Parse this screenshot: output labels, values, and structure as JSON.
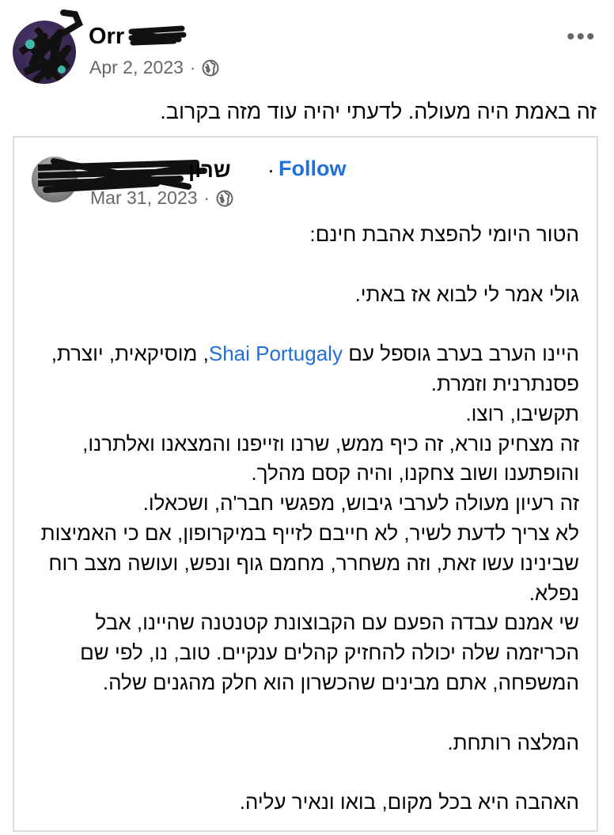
{
  "post": {
    "author": "Orr",
    "date": "Apr 2, 2023",
    "separator": "·",
    "more": "•••",
    "text": "זה באמת היה מעולה. לדעתי יהיה עוד מזה בקרוב."
  },
  "shared": {
    "author_visible": "שרון",
    "separator": "·",
    "follow": "Follow",
    "date": "Mar 31, 2023",
    "date_separator": "·",
    "lines": {
      "l1": "הטור היומי להפצת אהבת חינם:",
      "l2": "גולי אמר לי לבוא אז באתי.",
      "l3a": "היינו הערב בערב גוספל עם ",
      "l3link": "Shai Portugaly",
      "l3b": ", מוסיקאית, יוצרת, פסנתרנית וזמרת.",
      "l4": "תקשיבו, רוצו.",
      "l5": "זה מצחיק נורא, זה כיף ממש, שרנו וזייפנו והמצאנו ואלתרנו, והופתענו ושוב צחקנו, והיה קסם מהלך.",
      "l6": "זה רעיון מעולה לערבי גיבוש, מפגשי חבר'ה, ושכאלו.",
      "l7": "לא צריך לדעת לשיר, לא חייבם לזייף במיקרופון, אם כי האמיצות שבינינו עשו זאת, וזה משחרר, מחמם גוף ונפש, ועושה מצב רוח נפלא.",
      "l8": "שי אמנם עבדה הפעם עם הקבוצונת קטנטנה שהיינו, אבל הכריזמה שלה יכולה להחזיק קהלים ענקיים. טוב, נו, לפי שם המשפחה, אתם מבינים שהכשרון הוא חלק מהגנים שלה.",
      "l9": "המלצה רותחת.",
      "l10": "האהבה היא בכל מקום, בואו ונאיר עליה."
    }
  },
  "icons": {
    "privacy": "globe-icon",
    "menu": "more-options-icon"
  }
}
